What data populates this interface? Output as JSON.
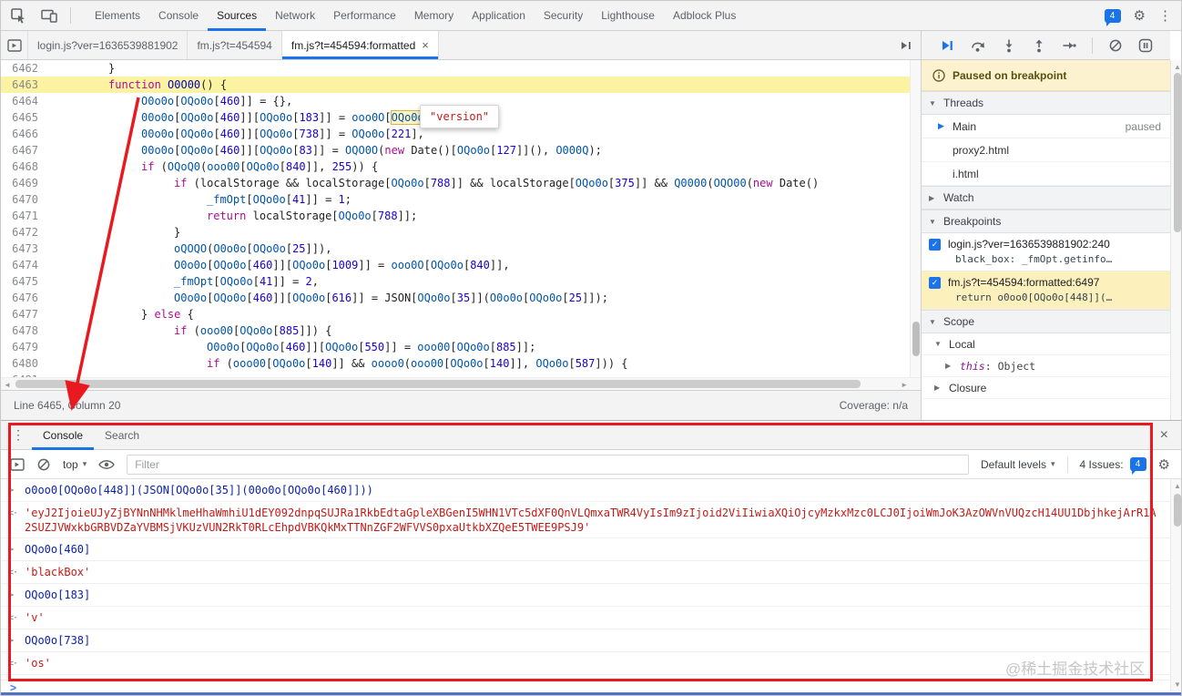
{
  "icons": {
    "gear": "⚙",
    "kebab": "⋮",
    "close": "×",
    "collapse": "▼",
    "expand": "▶",
    "caret": "▾",
    "up": "▲",
    "down": "▼",
    "left": "◄",
    "right": "►",
    "check": "✓",
    "command": ">",
    "result": "<·",
    "prompt": ">"
  },
  "main_tabbar": {
    "tabs": [
      {
        "label": "Elements",
        "active": false
      },
      {
        "label": "Console",
        "active": false
      },
      {
        "label": "Sources",
        "active": true
      },
      {
        "label": "Network",
        "active": false
      },
      {
        "label": "Performance",
        "active": false
      },
      {
        "label": "Memory",
        "active": false
      },
      {
        "label": "Application",
        "active": false
      },
      {
        "label": "Security",
        "active": false
      },
      {
        "label": "Lighthouse",
        "active": false
      },
      {
        "label": "Adblock Plus",
        "active": false
      }
    ],
    "issues_count": "4"
  },
  "file_tabbar": {
    "tabs": [
      {
        "label": "login.js?ver=1636539881902",
        "active": false,
        "closable": false
      },
      {
        "label": "fm.js?t=454594",
        "active": false,
        "closable": false
      },
      {
        "label": "fm.js?t=454594:formatted",
        "active": true,
        "closable": true
      }
    ]
  },
  "editor": {
    "exec_line": 6463,
    "tooltip_value": "\"version\"",
    "lines": [
      {
        "num": 6462,
        "indent": 0,
        "code": "}"
      },
      {
        "num": 6463,
        "indent": 0,
        "code": "function O0O00() {"
      },
      {
        "num": 6464,
        "indent": 1,
        "code": "O0o0o[OQo0o[460]] = {},"
      },
      {
        "num": 6465,
        "indent": 1,
        "code": "00o0o[OQo0o[460]][OQo0o[183]] = ooo0O[⟦OQo0o[251]⟧],"
      },
      {
        "num": 6466,
        "indent": 1,
        "code": "00o0o[OQo0o[460]][OQo0o[738]] = OQo0o[221],"
      },
      {
        "num": 6467,
        "indent": 1,
        "code": "00o0o[OQo0o[460]][OQo0o[83]] = OQO0O(new Date()[OQo0o[127]](), O000Q);"
      },
      {
        "num": 6468,
        "indent": 1,
        "code": "if (OQoQ0(ooo00[OQo0o[840]], 255)) {"
      },
      {
        "num": 6469,
        "indent": 2,
        "code": "if (localStorage && localStorage[OQo0o[788]] && localStorage[OQo0o[375]] && Q0000(OQO00(new Date()"
      },
      {
        "num": 6470,
        "indent": 3,
        "code": "_fmOpt[OQo0o[41]] = 1;"
      },
      {
        "num": 6471,
        "indent": 3,
        "code": "return localStorage[OQo0o[788]];"
      },
      {
        "num": 6472,
        "indent": 2,
        "code": "}"
      },
      {
        "num": 6473,
        "indent": 2,
        "code": "oQOQO(O0o0o[OQo0o[25]]),"
      },
      {
        "num": 6474,
        "indent": 2,
        "code": "O0o0o[OQo0o[460]][OQo0o[1009]] = ooo0O[OQo0o[840]],"
      },
      {
        "num": 6475,
        "indent": 2,
        "code": "_fmOpt[OQo0o[41]] = 2,"
      },
      {
        "num": 6476,
        "indent": 2,
        "code": "O0o0o[OQo0o[460]][OQo0o[616]] = JSON[OQo0o[35]](O0o0o[OQo0o[25]]);"
      },
      {
        "num": 6477,
        "indent": 1,
        "code": "} else {"
      },
      {
        "num": 6478,
        "indent": 2,
        "code": "if (ooo00[OQo0o[885]]) {"
      },
      {
        "num": 6479,
        "indent": 3,
        "code": "O0o0o[OQo0o[460]][OQo0o[550]] = ooo00[OQo0o[885]];"
      },
      {
        "num": 6480,
        "indent": 3,
        "code": "if (ooo00[OQo0o[140]] && oooo0(ooo00[OQo0o[140]], OQo0o[587])) {"
      },
      {
        "num": 6481,
        "indent": 2,
        "code": ""
      }
    ]
  },
  "status_bar": {
    "position": "Line 6465, Column 20",
    "coverage": "Coverage: n/a"
  },
  "sidebar": {
    "paused_message": "Paused on breakpoint",
    "threads": {
      "title": "Threads",
      "items": [
        {
          "label": "Main",
          "status": "paused",
          "current": true
        },
        {
          "label": "proxy2.html",
          "status": "",
          "current": false
        },
        {
          "label": "i.html",
          "status": "",
          "current": false
        }
      ]
    },
    "watch": {
      "title": "Watch"
    },
    "breakpoints": {
      "title": "Breakpoints",
      "items": [
        {
          "location": "login.js?ver=1636539881902:240",
          "snippet": "black_box: _fmOpt.getinfo…",
          "checked": true,
          "active": false
        },
        {
          "location": "fm.js?t=454594:formatted:6497",
          "snippet": "return o0oo0[OQo0o[448]](…",
          "checked": true,
          "active": true
        }
      ]
    },
    "scope": {
      "title": "Scope",
      "local_label": "Local",
      "this_name": "this",
      "this_value": "Object",
      "closure_label": "Closure"
    }
  },
  "console": {
    "tabs": [
      {
        "label": "Console",
        "active": true
      },
      {
        "label": "Search",
        "active": false
      }
    ],
    "toolbar": {
      "context": "top",
      "filter_placeholder": "Filter",
      "levels": "Default levels",
      "issues_label": "4 Issues:",
      "issues_count": "4"
    },
    "messages": [
      {
        "type": "command",
        "text": "o0oo0[OQo0o[448]](JSON[OQo0o[35]](00o0o[OQo0o[460]]))"
      },
      {
        "type": "result",
        "text": "'eyJ2IjoieUJyZjBYNnNHMklmeHhaWmhiU1dEY092dnpqSUJRa1RkbEdtaGpleXBGenI5WHN1VTc5dXF0QnVLQmxaTWR4VyIsIm9zIjoid2ViIiwiaXQiOjcyMzkxMzc0LCJ0IjoiWmJoK3AzOWVnVUQzcH14UU1DbjhkejArR1A2SUZJVWxkbGRBVDZaYVBMSjVKUzVUN2RkT0RLcEhpdVBKQkMxTTNnZGF2WFVVS0pxaUtkbXZQeE5TWEE9PSJ9'"
      },
      {
        "type": "command",
        "text": "OQo0o[460]"
      },
      {
        "type": "result",
        "text": "'blackBox'"
      },
      {
        "type": "command",
        "text": "OQo0o[183]"
      },
      {
        "type": "result",
        "text": "'v'"
      },
      {
        "type": "command",
        "text": "OQo0o[738]"
      },
      {
        "type": "result",
        "text": "'os'"
      }
    ]
  },
  "watermark": "@稀土掘金技术社区"
}
